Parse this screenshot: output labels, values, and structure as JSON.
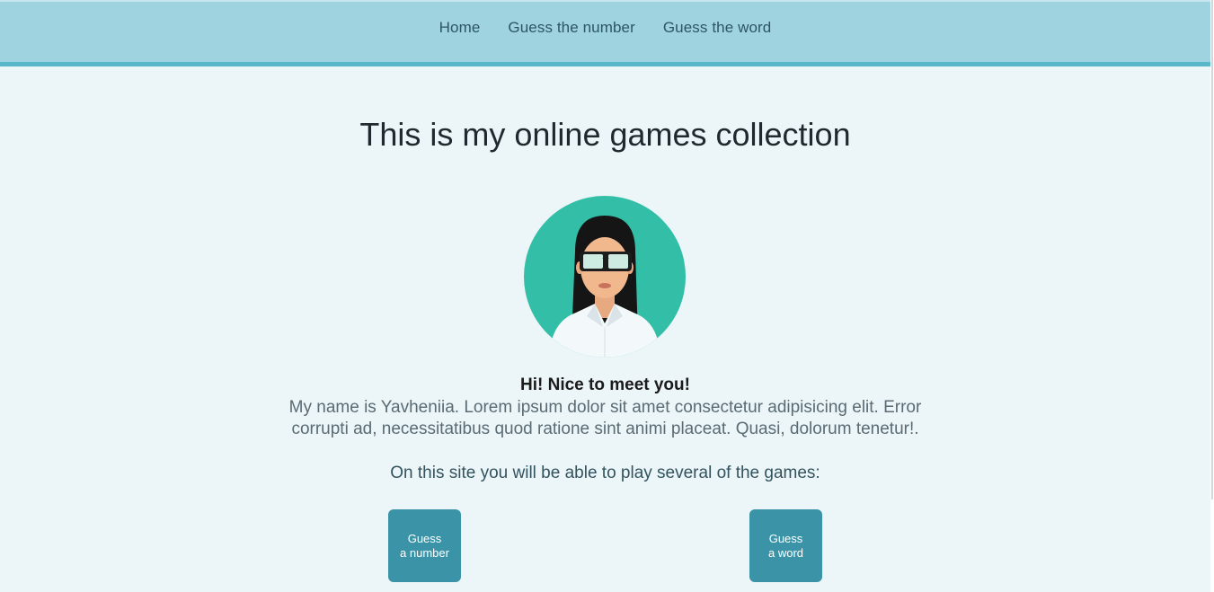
{
  "nav": {
    "items": [
      {
        "label": "Home"
      },
      {
        "label": "Guess the number"
      },
      {
        "label": "Guess the word"
      }
    ]
  },
  "main": {
    "title": "This is my online games collection",
    "greeting": "Hi! Nice to meet you!",
    "intro": "My name is Yavheniia. Lorem ipsum dolor sit amet consectetur adipisicing elit. Error corrupti ad, necessitatibus quod ratione sint animi placeat. Quasi, dolorum tenetur!.",
    "games_note": "On this site you will be able to play several of the games:",
    "buttons": {
      "guess_number": {
        "line1": "Guess",
        "line2": "a number"
      },
      "guess_word": {
        "line1": "Guess",
        "line2": "a word"
      }
    }
  },
  "colors": {
    "header_bg": "#9fd3e0",
    "header_border": "#5ab7ca",
    "page_bg": "#ecf6f9",
    "avatar_bg": "#33bfa7",
    "button_bg": "#3b93a8"
  },
  "icons": {
    "avatar": "woman-with-vr-goggles-avatar"
  }
}
